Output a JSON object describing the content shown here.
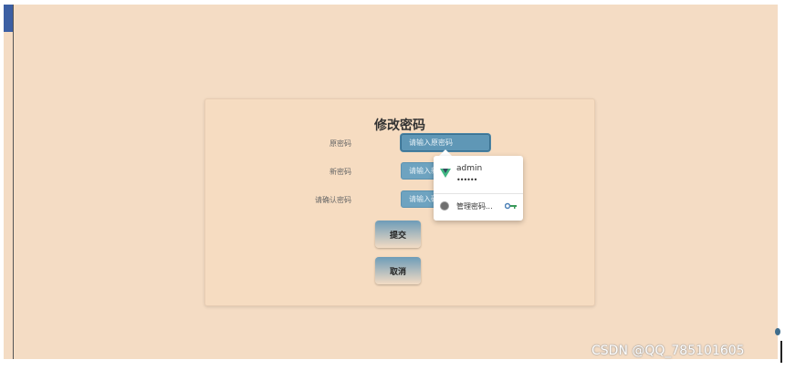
{
  "form": {
    "title": "修改密码",
    "old_password": {
      "label": "原密码",
      "placeholder": "请输入原密码"
    },
    "new_password": {
      "label": "新密码",
      "placeholder": "请输入新密码"
    },
    "confirm_password": {
      "label": "请确认密码",
      "placeholder": "请输入确认密码"
    },
    "submit_label": "提交",
    "cancel_label": "取消"
  },
  "autofill": {
    "username": "admin",
    "password_mask": "••••••",
    "manage_label": "管理密码..."
  },
  "watermark": "CSDN @QQ_785101605",
  "colors": {
    "page_bg": "#f4dcc4",
    "input_bg": "#6ea3c0",
    "vue_green": "#41b883",
    "vue_dark": "#35495e"
  },
  "icons": [
    "vue-icon",
    "gear-icon",
    "key-icon"
  ]
}
